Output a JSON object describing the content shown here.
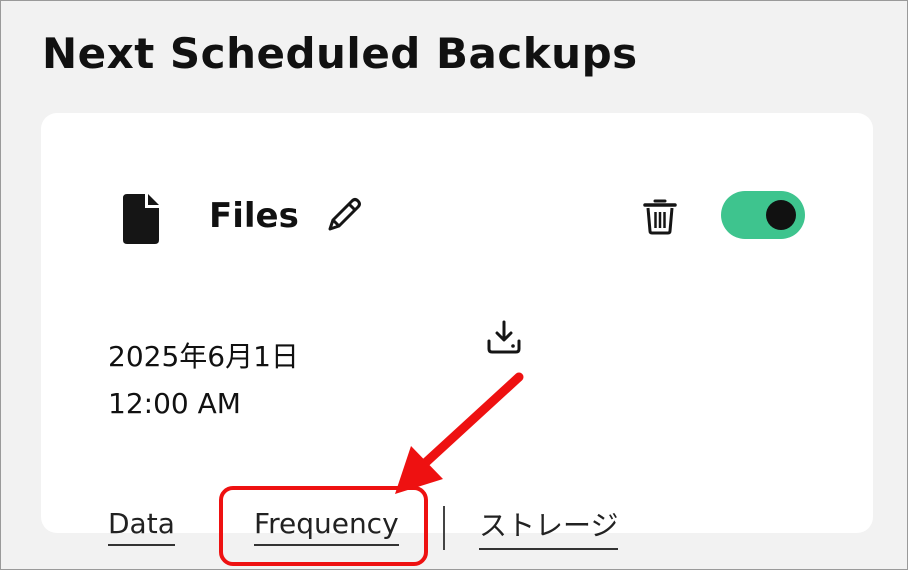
{
  "page": {
    "title": "Next Scheduled Backups"
  },
  "card": {
    "title": "Files",
    "icons": {
      "file": "file-icon",
      "edit": "pencil-icon",
      "delete": "trash-icon",
      "download": "download-icon"
    },
    "toggle": {
      "state": "on",
      "color": "#3ec48e"
    },
    "date": "2025年6月1日",
    "time": "12:00 AM"
  },
  "tabs": [
    {
      "label": "Data"
    },
    {
      "label": "Frequency"
    },
    {
      "label": "ストレージ"
    }
  ],
  "annotation": {
    "color": "#ee1111"
  }
}
